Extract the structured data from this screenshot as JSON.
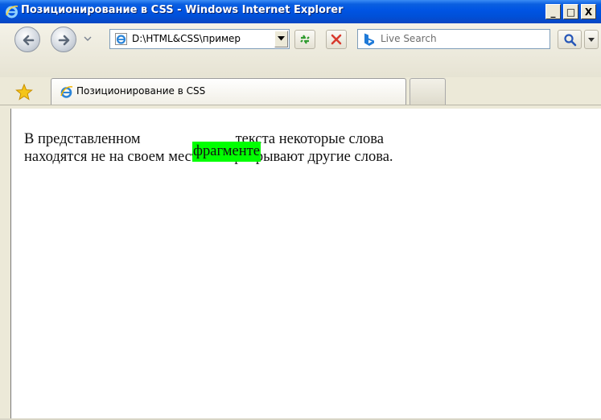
{
  "window": {
    "title": "Позиционирование в CSS - Windows Internet Explorer",
    "minimize_label": "_",
    "maximize_label": "□",
    "close_label": "X"
  },
  "navbar": {
    "address_value": "D:\\HTML&CSS\\пример",
    "search_placeholder": "Live Search"
  },
  "tabs": [
    {
      "label": "Позиционирование в CSS",
      "active": true
    },
    {
      "label": "",
      "active": false
    }
  ],
  "page": {
    "line1_before": "В представленном",
    "line1_after": "текста некоторые слова",
    "line2": "находятся не на своем месте и перекрывают другие слова.",
    "positioned_word": "фрагменте",
    "positioned_word_bg": "#00ff00"
  },
  "colors": {
    "titlebar": "#0054e3",
    "chrome": "#ece9d8"
  },
  "icons": [
    "ie-icon",
    "back-arrow-icon",
    "forward-arrow-icon",
    "refresh-icon",
    "stop-icon",
    "bing-icon",
    "search-magnifier-icon",
    "favorites-star-icon"
  ]
}
